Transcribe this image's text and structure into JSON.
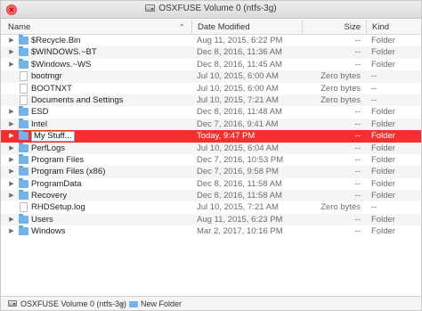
{
  "window": {
    "title": "OSXFUSE Volume 0 (ntfs-3g)",
    "close_glyph": "×"
  },
  "columns": {
    "name": "Name",
    "date": "Date Modified",
    "size": "Size",
    "kind": "Kind",
    "sort_glyph": "⌃"
  },
  "rows": [
    {
      "name": "$Recycle.Bin",
      "date": "Aug 11, 2015, 6:22 PM",
      "size": "--",
      "kind": "Folder",
      "icon": "folder-icon",
      "disclosure": "▶"
    },
    {
      "name": "$WINDOWS.~BT",
      "date": "Dec 8, 2016, 11:36 AM",
      "size": "--",
      "kind": "Folder",
      "icon": "folder-icon",
      "disclosure": "▶"
    },
    {
      "name": "$Windows.~WS",
      "date": "Dec 8, 2016, 11:45 AM",
      "size": "--",
      "kind": "Folder",
      "icon": "folder-icon",
      "disclosure": "▶"
    },
    {
      "name": "bootmgr",
      "date": "Jul 10, 2015, 6:00 AM",
      "size": "Zero bytes",
      "kind": "--",
      "icon": "file-icon",
      "disclosure": ""
    },
    {
      "name": "BOOTNXT",
      "date": "Jul 10, 2015, 6:00 AM",
      "size": "Zero bytes",
      "kind": "--",
      "icon": "file-icon",
      "disclosure": ""
    },
    {
      "name": "Documents and Settings",
      "date": "Jul 10, 2015, 7:21 AM",
      "size": "Zero bytes",
      "kind": "--",
      "icon": "file-icon",
      "disclosure": ""
    },
    {
      "name": "ESD",
      "date": "Dec 8, 2016, 11:48 AM",
      "size": "--",
      "kind": "Folder",
      "icon": "folder-icon",
      "disclosure": "▶"
    },
    {
      "name": "Intel",
      "date": "Dec 7, 2016, 9:41 AM",
      "size": "--",
      "kind": "Folder",
      "icon": "folder-icon",
      "disclosure": "▶"
    },
    {
      "name": "My Stuff...",
      "date": "Today, 9:47 PM",
      "size": "--",
      "kind": "Folder",
      "icon": "folder-icon",
      "disclosure": "▶",
      "selected": true
    },
    {
      "name": "PerfLogs",
      "date": "Jul 10, 2015, 6:04 AM",
      "size": "--",
      "kind": "Folder",
      "icon": "folder-icon",
      "disclosure": "▶"
    },
    {
      "name": "Program Files",
      "date": "Dec 7, 2016, 10:53 PM",
      "size": "--",
      "kind": "Folder",
      "icon": "folder-icon",
      "disclosure": "▶"
    },
    {
      "name": "Program Files (x86)",
      "date": "Dec 7, 2016, 9:58 PM",
      "size": "--",
      "kind": "Folder",
      "icon": "folder-icon",
      "disclosure": "▶"
    },
    {
      "name": "ProgramData",
      "date": "Dec 8, 2016, 11:58 AM",
      "size": "--",
      "kind": "Folder",
      "icon": "folder-icon",
      "disclosure": "▶"
    },
    {
      "name": "Recovery",
      "date": "Dec 8, 2016, 11:58 AM",
      "size": "--",
      "kind": "Folder",
      "icon": "folder-icon",
      "disclosure": "▶"
    },
    {
      "name": "RHDSetup.log",
      "date": "Jul 10, 2015, 7:21 AM",
      "size": "Zero bytes",
      "kind": "--",
      "icon": "file-icon",
      "disclosure": ""
    },
    {
      "name": "Users",
      "date": "Aug 11, 2015, 6:23 PM",
      "size": "--",
      "kind": "Folder",
      "icon": "folder-icon",
      "disclosure": "▶"
    },
    {
      "name": "Windows",
      "date": "Mar 2, 2017, 10:16 PM",
      "size": "--",
      "kind": "Folder",
      "icon": "folder-icon",
      "disclosure": "▶"
    }
  ],
  "pathbar": {
    "volume": "OSXFUSE Volume 0 (ntfs-3g)",
    "separator": "▸",
    "folder": "New Folder"
  },
  "colors": {
    "selection": "#f52f2f",
    "folder": "#74b3e8",
    "close_button": "#fc605b"
  }
}
